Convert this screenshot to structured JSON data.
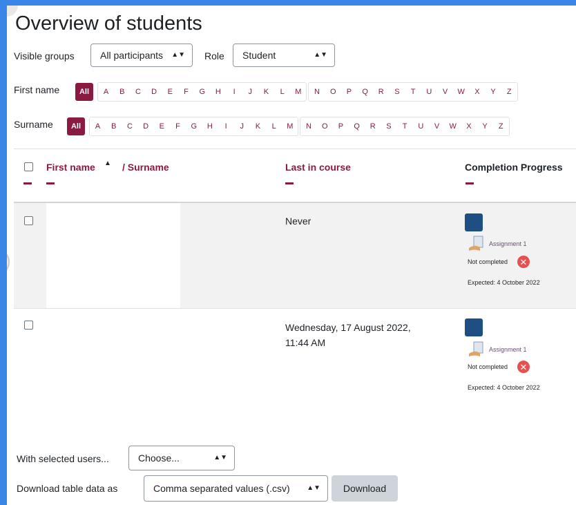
{
  "page_title": "Overview of students",
  "filters": {
    "groups_label": "Visible groups",
    "groups_value": "All participants",
    "role_label": "Role",
    "role_value": "Student"
  },
  "initials": {
    "first_name_label": "First name",
    "surname_label": "Surname",
    "all_label": "All",
    "letters": [
      "A",
      "B",
      "C",
      "D",
      "E",
      "F",
      "G",
      "H",
      "I",
      "J",
      "K",
      "L",
      "M",
      "N",
      "O",
      "P",
      "Q",
      "R",
      "S",
      "T",
      "U",
      "V",
      "W",
      "X",
      "Y",
      "Z"
    ]
  },
  "table": {
    "col_firstname": "First name",
    "col_sort_arrow": "▲",
    "col_surname": "/ Surname",
    "col_last_in_course": "Last in course",
    "col_completion": "Completion Progress",
    "rows": [
      {
        "last_in_course": "Never",
        "last_in_course_2": "",
        "assignment": "Assignment 1",
        "status": "Not completed",
        "expected": "Expected: 4 October 2022"
      },
      {
        "last_in_course": "Wednesday, 17 August 2022,",
        "last_in_course_2": "11:44 AM",
        "assignment": "Assignment 1",
        "status": "Not completed",
        "expected": "Expected: 4 October 2022"
      }
    ]
  },
  "bulk": {
    "with_selected_label": "With selected users...",
    "with_selected_value": "Choose...",
    "download_label": "Download table data as",
    "download_format": "Comma separated values (.csv)",
    "download_button": "Download"
  },
  "colors": {
    "accent": "#8b1a42",
    "progress_block": "#1f4f82",
    "not_completed": "#e8504f",
    "page_bg": "#3a86e8"
  }
}
